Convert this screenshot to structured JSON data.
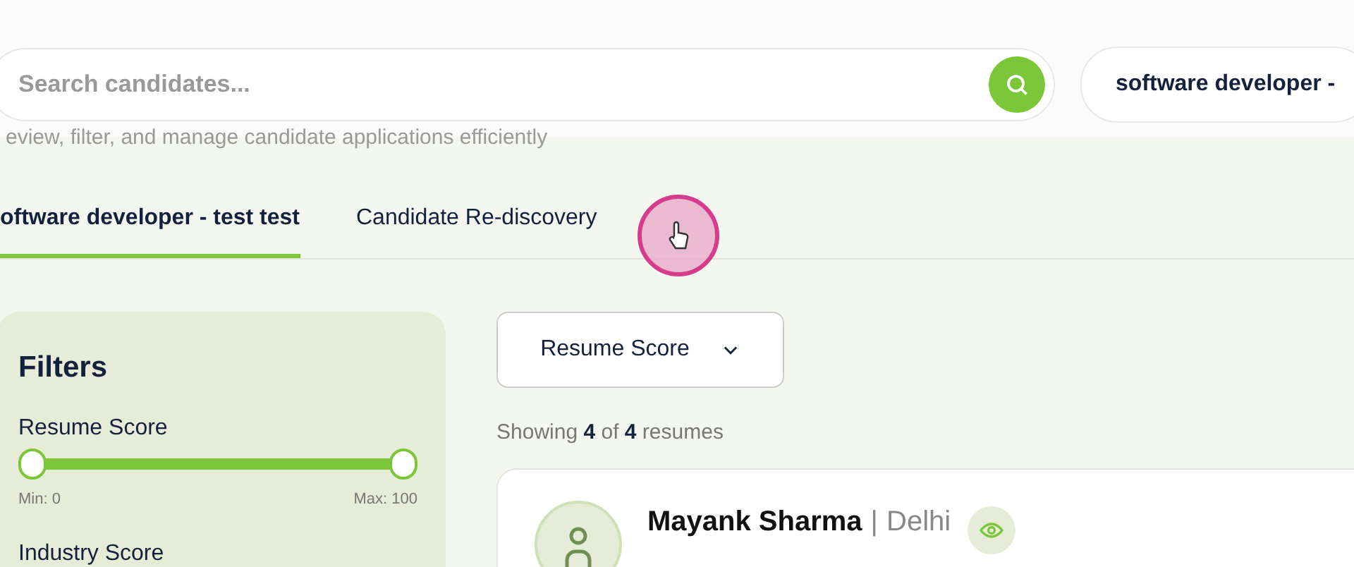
{
  "search": {
    "placeholder": "Search candidates..."
  },
  "job_select": {
    "value": "software developer -"
  },
  "subtitle": "eview, filter, and manage candidate applications efficiently",
  "tabs": [
    {
      "label": "oftware developer - test test",
      "selected": true
    },
    {
      "label": "Candidate Re-discovery",
      "selected": false
    }
  ],
  "filters": {
    "title": "Filters",
    "groups": [
      {
        "label": "Resume Score",
        "thumbs": [
          {
            "level": 0
          },
          {
            "level": 1
          }
        ],
        "min": "Min: 0",
        "max": "Max: 100"
      },
      {
        "label": "Industry Score"
      }
    ]
  },
  "sort": {
    "value": "Resume Score"
  },
  "summary": "Showing **4** of **4** resumes",
  "candidates": [
    {
      "name": "Mayank Sharma",
      "separator": "|",
      "location": "Delhi"
    }
  ]
}
